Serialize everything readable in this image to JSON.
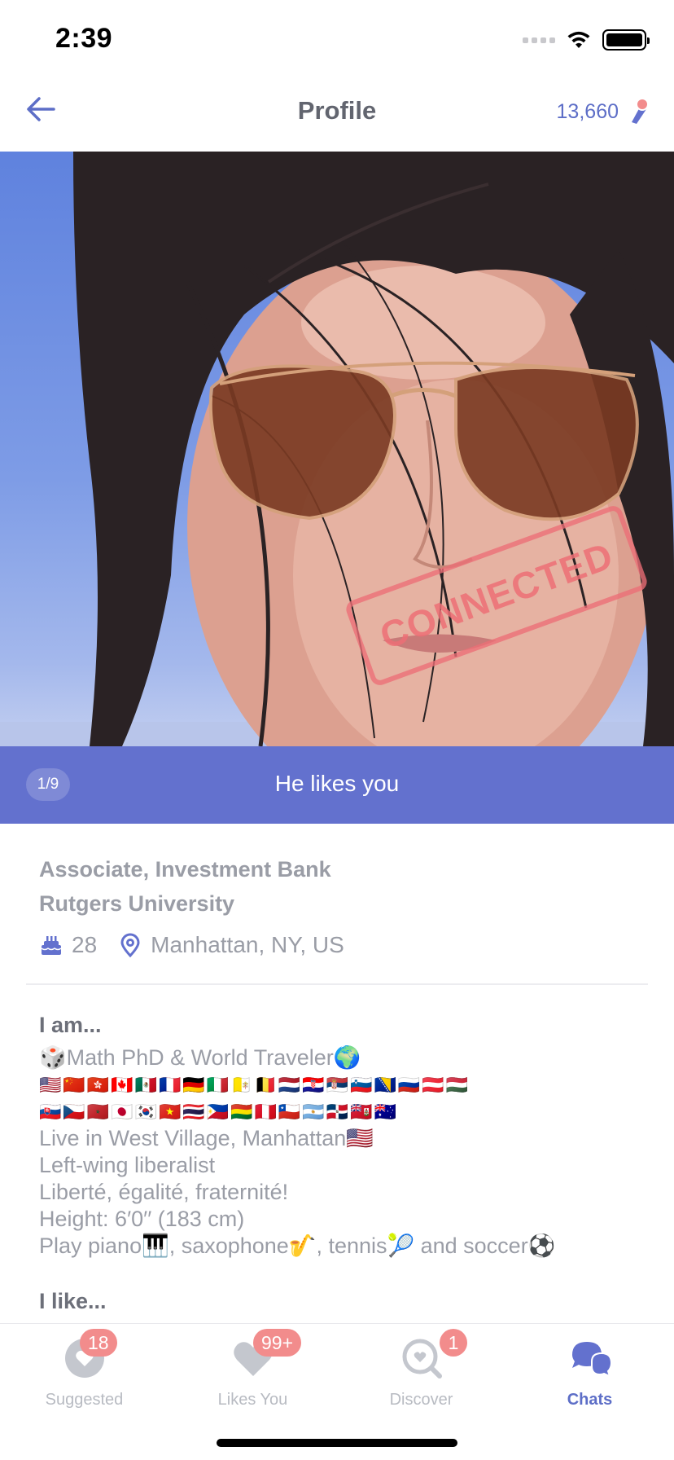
{
  "status_bar": {
    "time": "2:39"
  },
  "header": {
    "title": "Profile",
    "coins": "13,660"
  },
  "photo": {
    "stamp": "CONNECTED",
    "counter": "1/9",
    "likes_text": "He likes you"
  },
  "profile": {
    "job": "Associate, Investment Bank",
    "school": "Rutgers University",
    "age": "28",
    "location": "Manhattan, NY, US"
  },
  "about": {
    "heading": "I am...",
    "line1": "🎲Math PhD & World Traveler🌍",
    "flags1": "🇺🇸🇨🇳🇭🇰🇨🇦🇲🇽🇫🇷🇩🇪🇮🇹🇻🇦🇧🇪🇳🇱🇭🇷🇷🇸🇸🇮🇧🇦🇷🇺🇦🇹🇭🇺",
    "flags2": "🇸🇰🇨🇿🇲🇦🇯🇵🇰🇷🇻🇳🇹🇭🇵🇭🇧🇴🇵🇪🇨🇱🇦🇷🇩🇴🇧🇲🇦🇺",
    "line2": "Live in West Village, Manhattan🇺🇸",
    "line3": "Left-wing liberalist",
    "line4": "Liberté, égalité, fraternité!",
    "line5": "Height: 6′0′′ (183 cm)",
    "line6": "Play piano🎹, saxophone🎷, tennis🎾 and soccer⚽",
    "like_heading": "I like..."
  },
  "tabs": [
    {
      "label": "Suggested",
      "badge": "18"
    },
    {
      "label": "Likes You",
      "badge": "99+"
    },
    {
      "label": "Discover",
      "badge": "1"
    },
    {
      "label": "Chats",
      "badge": ""
    }
  ],
  "colors": {
    "accent": "#6371ce",
    "badge": "#f28c8c",
    "text_muted": "#9a9da6"
  }
}
